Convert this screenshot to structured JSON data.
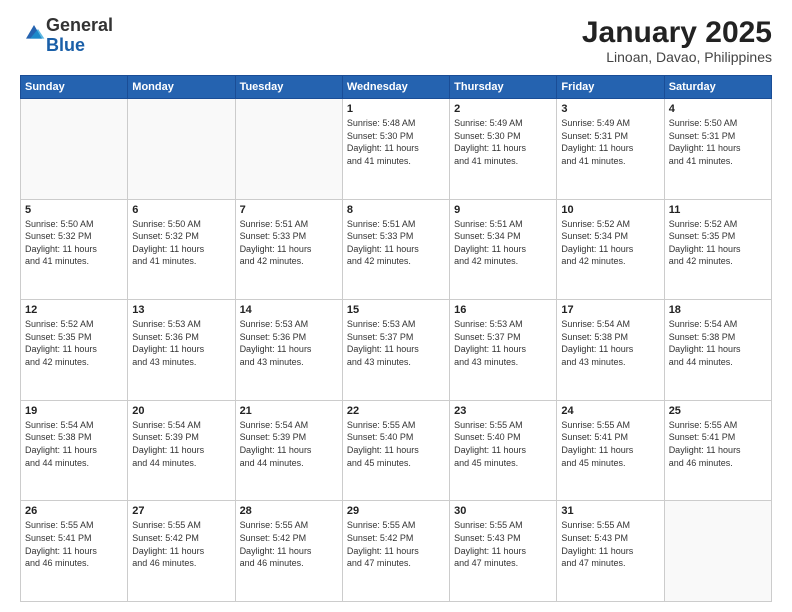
{
  "logo": {
    "general": "General",
    "blue": "Blue"
  },
  "title": "January 2025",
  "subtitle": "Linoan, Davao, Philippines",
  "days_header": [
    "Sunday",
    "Monday",
    "Tuesday",
    "Wednesday",
    "Thursday",
    "Friday",
    "Saturday"
  ],
  "weeks": [
    [
      {
        "day": "",
        "info": ""
      },
      {
        "day": "",
        "info": ""
      },
      {
        "day": "",
        "info": ""
      },
      {
        "day": "1",
        "info": "Sunrise: 5:48 AM\nSunset: 5:30 PM\nDaylight: 11 hours\nand 41 minutes."
      },
      {
        "day": "2",
        "info": "Sunrise: 5:49 AM\nSunset: 5:30 PM\nDaylight: 11 hours\nand 41 minutes."
      },
      {
        "day": "3",
        "info": "Sunrise: 5:49 AM\nSunset: 5:31 PM\nDaylight: 11 hours\nand 41 minutes."
      },
      {
        "day": "4",
        "info": "Sunrise: 5:50 AM\nSunset: 5:31 PM\nDaylight: 11 hours\nand 41 minutes."
      }
    ],
    [
      {
        "day": "5",
        "info": "Sunrise: 5:50 AM\nSunset: 5:32 PM\nDaylight: 11 hours\nand 41 minutes."
      },
      {
        "day": "6",
        "info": "Sunrise: 5:50 AM\nSunset: 5:32 PM\nDaylight: 11 hours\nand 41 minutes."
      },
      {
        "day": "7",
        "info": "Sunrise: 5:51 AM\nSunset: 5:33 PM\nDaylight: 11 hours\nand 42 minutes."
      },
      {
        "day": "8",
        "info": "Sunrise: 5:51 AM\nSunset: 5:33 PM\nDaylight: 11 hours\nand 42 minutes."
      },
      {
        "day": "9",
        "info": "Sunrise: 5:51 AM\nSunset: 5:34 PM\nDaylight: 11 hours\nand 42 minutes."
      },
      {
        "day": "10",
        "info": "Sunrise: 5:52 AM\nSunset: 5:34 PM\nDaylight: 11 hours\nand 42 minutes."
      },
      {
        "day": "11",
        "info": "Sunrise: 5:52 AM\nSunset: 5:35 PM\nDaylight: 11 hours\nand 42 minutes."
      }
    ],
    [
      {
        "day": "12",
        "info": "Sunrise: 5:52 AM\nSunset: 5:35 PM\nDaylight: 11 hours\nand 42 minutes."
      },
      {
        "day": "13",
        "info": "Sunrise: 5:53 AM\nSunset: 5:36 PM\nDaylight: 11 hours\nand 43 minutes."
      },
      {
        "day": "14",
        "info": "Sunrise: 5:53 AM\nSunset: 5:36 PM\nDaylight: 11 hours\nand 43 minutes."
      },
      {
        "day": "15",
        "info": "Sunrise: 5:53 AM\nSunset: 5:37 PM\nDaylight: 11 hours\nand 43 minutes."
      },
      {
        "day": "16",
        "info": "Sunrise: 5:53 AM\nSunset: 5:37 PM\nDaylight: 11 hours\nand 43 minutes."
      },
      {
        "day": "17",
        "info": "Sunrise: 5:54 AM\nSunset: 5:38 PM\nDaylight: 11 hours\nand 43 minutes."
      },
      {
        "day": "18",
        "info": "Sunrise: 5:54 AM\nSunset: 5:38 PM\nDaylight: 11 hours\nand 44 minutes."
      }
    ],
    [
      {
        "day": "19",
        "info": "Sunrise: 5:54 AM\nSunset: 5:38 PM\nDaylight: 11 hours\nand 44 minutes."
      },
      {
        "day": "20",
        "info": "Sunrise: 5:54 AM\nSunset: 5:39 PM\nDaylight: 11 hours\nand 44 minutes."
      },
      {
        "day": "21",
        "info": "Sunrise: 5:54 AM\nSunset: 5:39 PM\nDaylight: 11 hours\nand 44 minutes."
      },
      {
        "day": "22",
        "info": "Sunrise: 5:55 AM\nSunset: 5:40 PM\nDaylight: 11 hours\nand 45 minutes."
      },
      {
        "day": "23",
        "info": "Sunrise: 5:55 AM\nSunset: 5:40 PM\nDaylight: 11 hours\nand 45 minutes."
      },
      {
        "day": "24",
        "info": "Sunrise: 5:55 AM\nSunset: 5:41 PM\nDaylight: 11 hours\nand 45 minutes."
      },
      {
        "day": "25",
        "info": "Sunrise: 5:55 AM\nSunset: 5:41 PM\nDaylight: 11 hours\nand 46 minutes."
      }
    ],
    [
      {
        "day": "26",
        "info": "Sunrise: 5:55 AM\nSunset: 5:41 PM\nDaylight: 11 hours\nand 46 minutes."
      },
      {
        "day": "27",
        "info": "Sunrise: 5:55 AM\nSunset: 5:42 PM\nDaylight: 11 hours\nand 46 minutes."
      },
      {
        "day": "28",
        "info": "Sunrise: 5:55 AM\nSunset: 5:42 PM\nDaylight: 11 hours\nand 46 minutes."
      },
      {
        "day": "29",
        "info": "Sunrise: 5:55 AM\nSunset: 5:42 PM\nDaylight: 11 hours\nand 47 minutes."
      },
      {
        "day": "30",
        "info": "Sunrise: 5:55 AM\nSunset: 5:43 PM\nDaylight: 11 hours\nand 47 minutes."
      },
      {
        "day": "31",
        "info": "Sunrise: 5:55 AM\nSunset: 5:43 PM\nDaylight: 11 hours\nand 47 minutes."
      },
      {
        "day": "",
        "info": ""
      }
    ]
  ]
}
